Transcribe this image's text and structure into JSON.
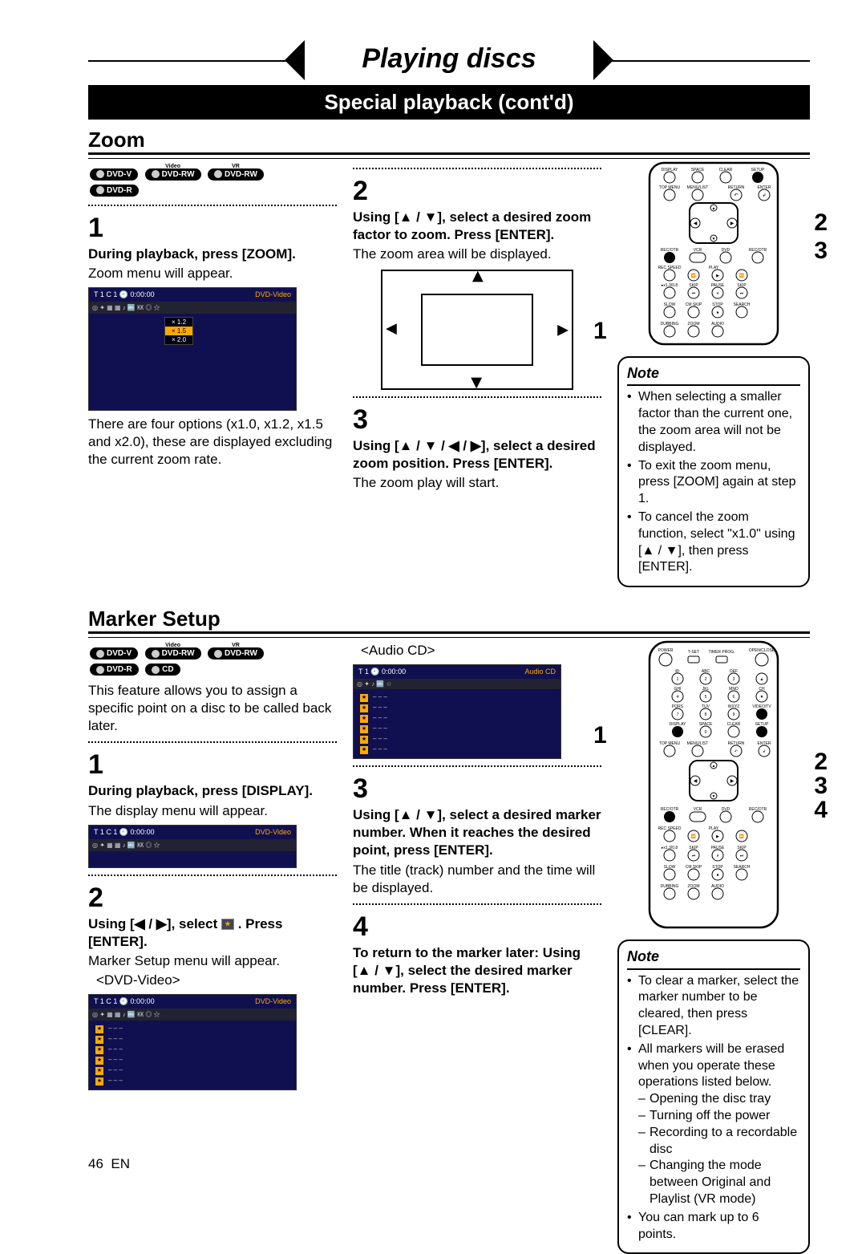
{
  "header": {
    "title": "Playing discs",
    "subtitle": "Special playback (cont'd)"
  },
  "zoom": {
    "title": "Zoom",
    "badges": [
      "DVD-V",
      "DVD-RW",
      "DVD-RW",
      "DVD-R"
    ],
    "badge_sup": [
      "",
      "Video",
      "VR",
      ""
    ],
    "step1_num": "1",
    "step1_bold": "During playback, press [ZOOM].",
    "step1_text": "Zoom menu will appear.",
    "osd1_hdr_left": "T  1  C 1  🕘 0:00:00",
    "osd1_hdr_right": "DVD-Video",
    "osd_icons": "◎ ✦ ▦ ▦ ♪ 🔤 ㏍ ◎ ☆",
    "osd1_opts": [
      "× 1.2",
      "× 1.5",
      "× 2.0"
    ],
    "step1_foot": "There are four options (x1.0, x1.2, x1.5 and x2.0), these are displayed excluding the current zoom rate.",
    "step2_num": "2",
    "step2_bold": "Using [▲ / ▼], select a desired zoom factor to zoom. Press [ENTER].",
    "step2_text": "The zoom area will be displayed.",
    "step3_num": "3",
    "step3_bold": "Using [▲ / ▼ / ◀ / ▶], select a desired zoom position. Press [ENTER].",
    "step3_text": "The zoom play will start.",
    "ref": {
      "r1": "1",
      "r2": "2",
      "r3": "3"
    },
    "note_title": "Note",
    "notes": [
      "When selecting a smaller factor than the current one, the zoom area will not be displayed.",
      "To exit the zoom menu, press [ZOOM] again at step 1.",
      "To cancel the zoom function, select \"x1.0\" using [▲ / ▼], then press [ENTER]."
    ]
  },
  "marker": {
    "title": "Marker Setup",
    "badges": [
      "DVD-V",
      "DVD-RW",
      "DVD-RW",
      "DVD-R",
      "CD"
    ],
    "badge_sup": [
      "",
      "Video",
      "VR",
      "",
      ""
    ],
    "intro": "This feature allows you to assign a specific point on a disc to be called back later.",
    "step1_num": "1",
    "step1_bold": "During playback, press [DISPLAY].",
    "step1_text": "The display menu will appear.",
    "osd1_hdr_left": "T  1  C 1  🕘 0:00:00",
    "osd1_hdr_right": "DVD-Video",
    "step2_num": "2",
    "step2_bold_a": "Using [◀ / ▶], select ",
    "step2_bold_b": " . Press [ENTER].",
    "step2_text": "Marker Setup menu will appear.",
    "osd2_label": "<DVD-Video>",
    "osd2_hdr_left": "T  1  C 1  🕘 0:00:00",
    "osd2_hdr_right": "DVD-Video",
    "marker_rows": [
      "– – –",
      "– – –",
      "– – –",
      "– – –",
      "– – –",
      "– – –"
    ],
    "osd3_label": "<Audio CD>",
    "osd3_hdr_left": "T  1  🕘 0:00:00",
    "osd3_hdr_right": "Audio CD",
    "step3_num": "3",
    "step3_bold": "Using [▲ / ▼], select a desired marker number. When it reaches the desired point, press [ENTER].",
    "step3_text": "The title (track) number and the time will be displayed.",
    "step4_num": "4",
    "step4_bold": "To return to the marker later: Using [▲ / ▼], select the desired marker number. Press [ENTER].",
    "ref": {
      "r1": "1",
      "r2": "2",
      "r3": "3",
      "r4": "4"
    },
    "note_title": "Note",
    "notes_simple": [
      "To clear a marker, select the marker number to be cleared, then press [CLEAR].",
      "All markers will be erased when you operate these operations listed below."
    ],
    "sub_notes": [
      "Opening the disc tray",
      "Turning off the power",
      "Recording to a recordable disc",
      "Changing the mode between Original and Playlist (VR mode)"
    ],
    "notes_last": "You can mark up to 6 points."
  },
  "remote_labels_top": [
    "DISPLAY",
    "SPACE",
    "CLEAR",
    "SETUP",
    "TOP MENU",
    "MENU/LIST",
    "RETURN",
    "ENTER",
    "REC/OTR",
    "VCR",
    "DVD",
    "REC/OTR",
    "REC SPEED",
    "PLAY",
    "▸x1.3/0.8",
    "SKIP",
    "PAUSE",
    "SKIP",
    "SLOW",
    "CM SKIP",
    "STOP",
    "SEARCH",
    "DUBBING",
    "ZOOM",
    "AUDIO"
  ],
  "remote_labels_full": [
    "POWER",
    "T-SET",
    "TIMER PROG.",
    "OPEN/CLOSE",
    "@:",
    "ABC",
    "DEF",
    "1",
    "2",
    "3",
    "GHI",
    "JKL",
    "MNO",
    "CH",
    "4",
    "5",
    "6",
    "PQRS",
    "TUV",
    "WXYZ",
    "VIDEO/TV",
    "7",
    "8",
    "9",
    "DISPLAY",
    "SPACE",
    "CLEAR",
    "SETUP",
    "0",
    "TOP MENU",
    "MENU/LIST",
    "RETURN",
    "ENTER",
    "REC/OTR",
    "VCR",
    "DVD",
    "REC/OTR",
    "REC SPEED",
    "PLAY",
    "▸x1.3/0.8",
    "SKIP",
    "PAUSE",
    "SKIP",
    "SLOW",
    "CM SKIP",
    "STOP",
    "SEARCH",
    "DUBBING",
    "ZOOM",
    "AUDIO"
  ],
  "footer": {
    "page": "46",
    "lang": "EN"
  }
}
